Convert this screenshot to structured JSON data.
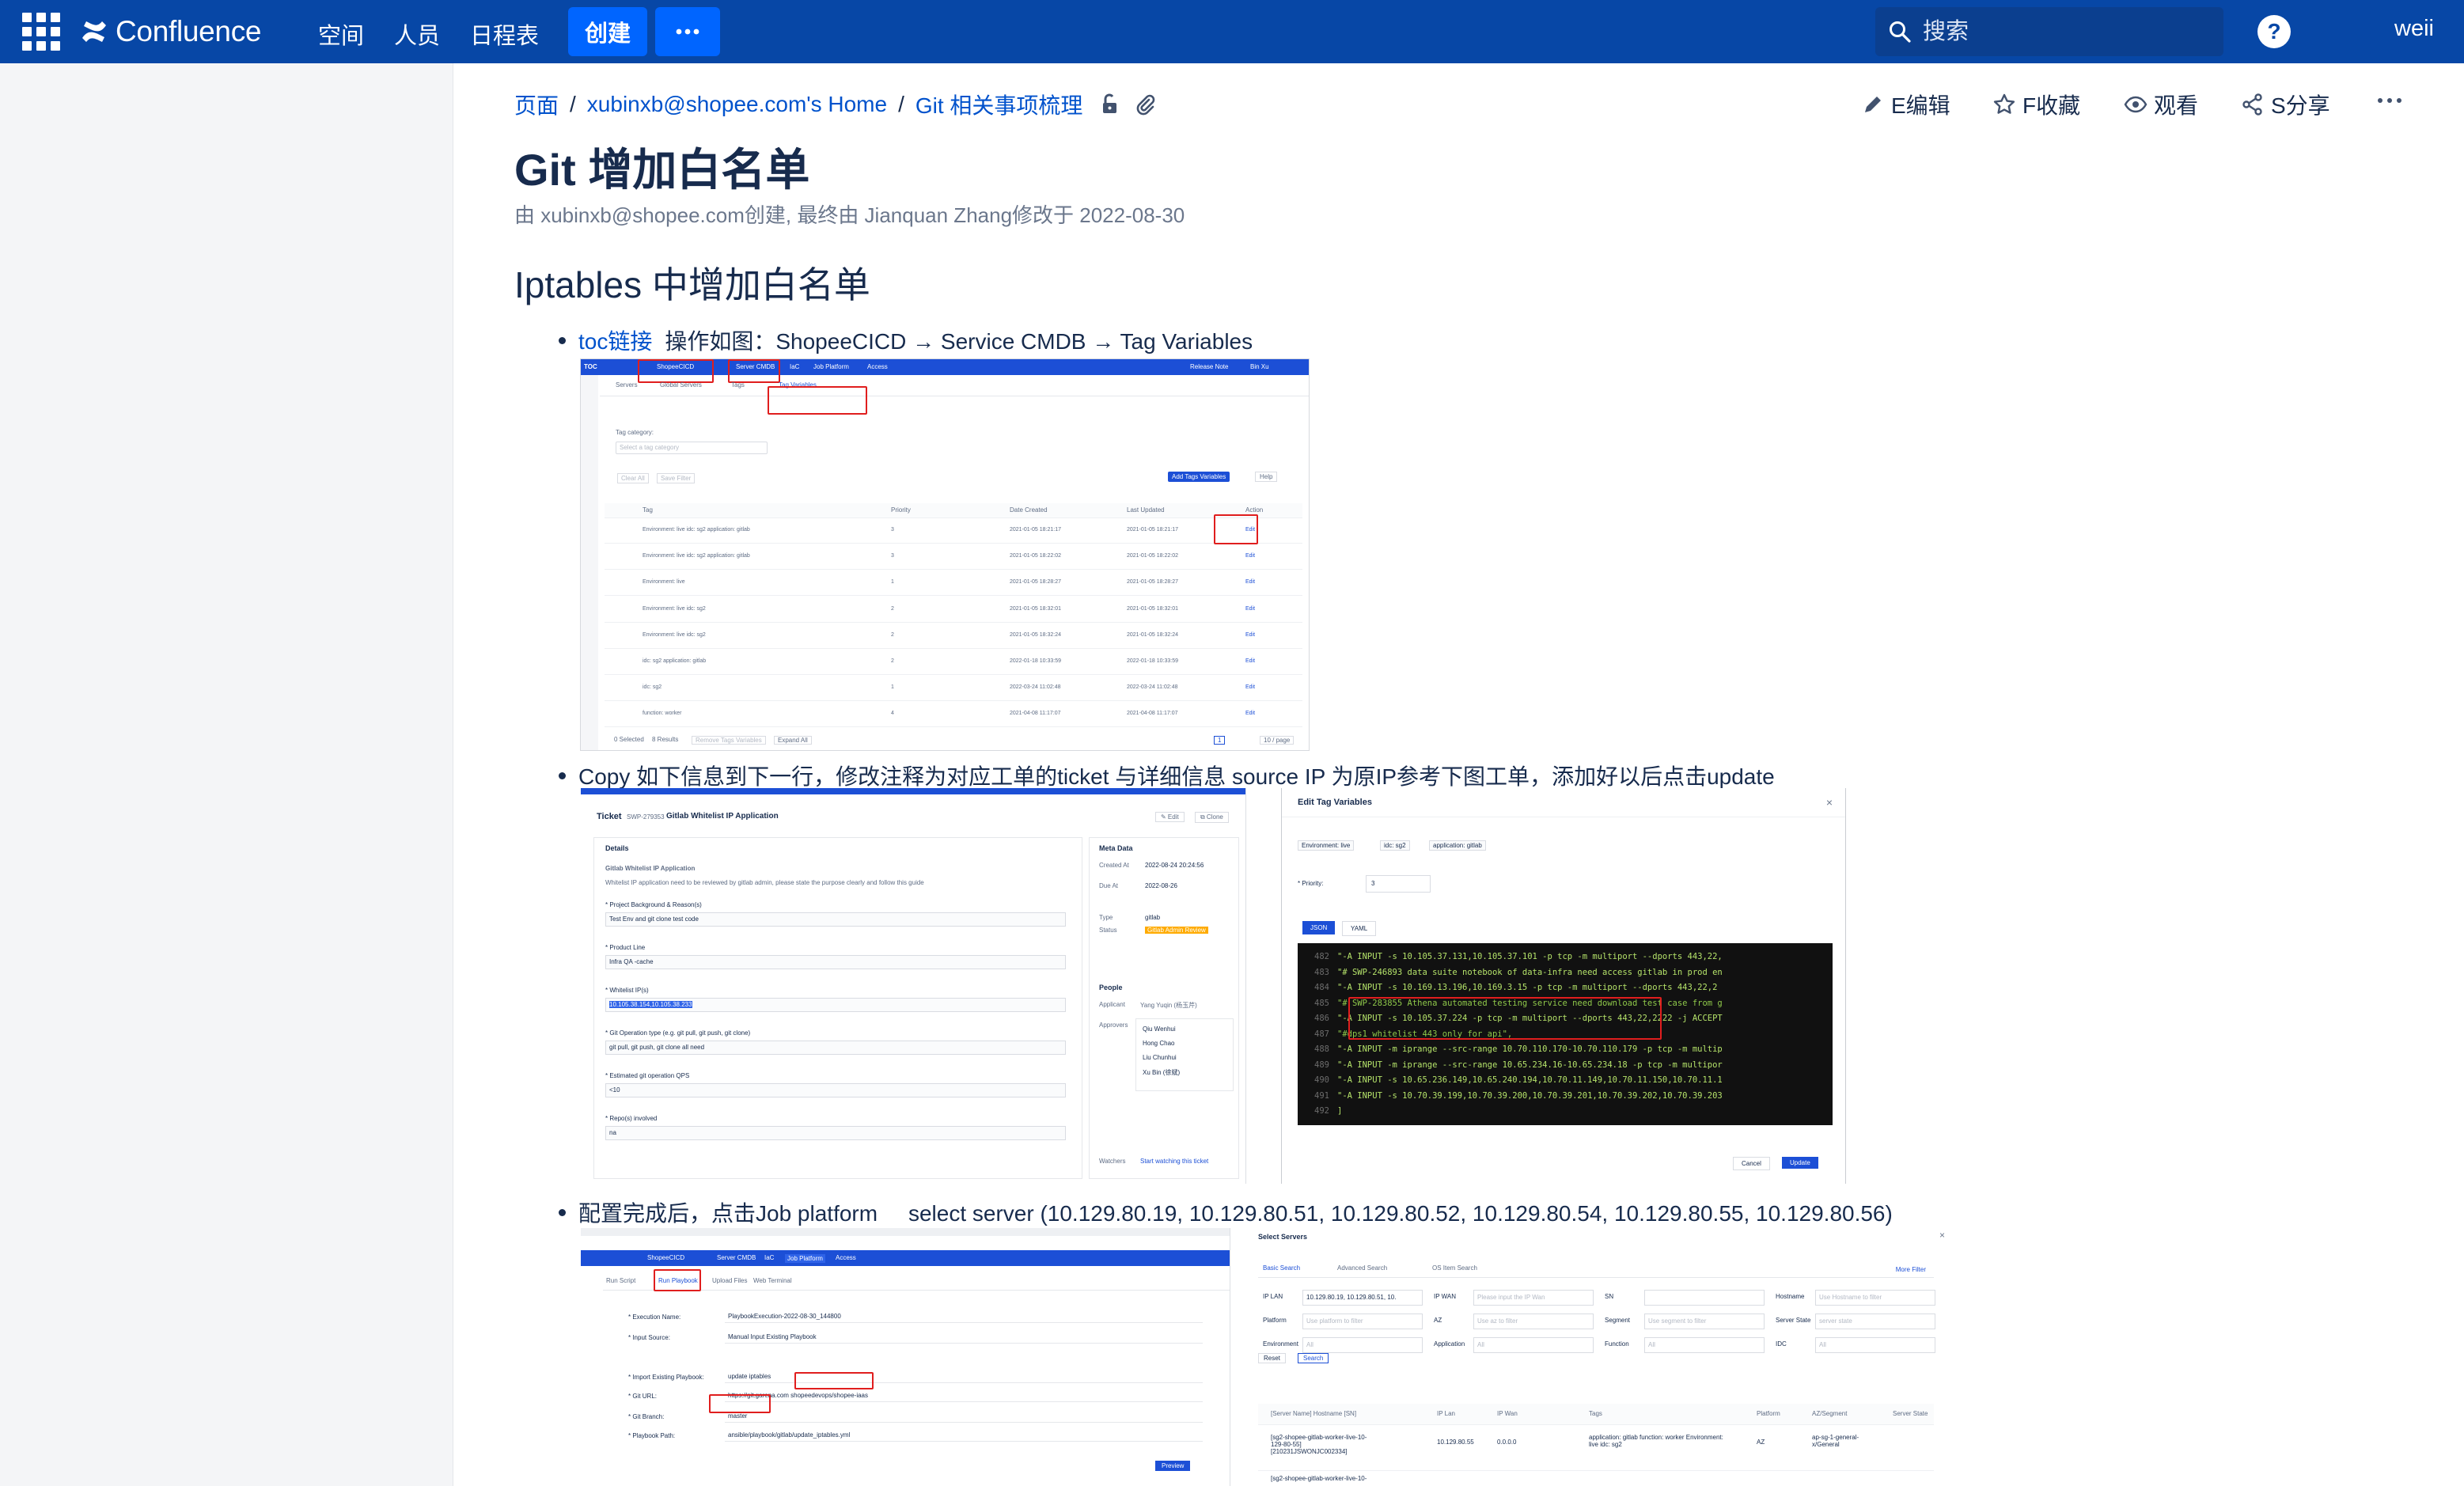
{
  "nav": {
    "brand": "Confluence",
    "links": [
      "空间",
      "人员",
      "日程表"
    ],
    "create": "创建",
    "search_placeholder": "搜索",
    "user": "weii"
  },
  "breadcrumb": [
    "页面",
    "xubinxb@shopee.com's Home",
    "Git 相关事项梳理"
  ],
  "actions": {
    "edit": "E编辑",
    "favorite": "F收藏",
    "watch": "观看",
    "share": "S分享"
  },
  "page": {
    "title": "Git 增加白名单",
    "byline": "由 xubinxb@shopee.com创建, 最终由 Jianquan Zhang修改于 2022-08-30",
    "section": "Iptables 中增加白名单"
  },
  "bullets": {
    "b1_link": "toc链接",
    "b1_text": "操作如图：ShopeeCICD → Service CMDB → Tag Variables",
    "b2_text": "Copy 如下信息到下一行，修改注释为对应工单的ticket 与详细信息 source IP 为原IP参考下图工单，添加好以后点击update",
    "b3_text": "配置完成后，点击Job platform     select server (10.129.80.19, 10.129.80.51, 10.129.80.52, 10.129.80.54, 10.129.80.55, 10.129.80.56)"
  },
  "shot1": {
    "menu": [
      "ShopeeCICD",
      "Server CMDB",
      "IaC",
      "Job Platform",
      "Access"
    ],
    "right": [
      "Release Note",
      "Bin Xu"
    ],
    "tabs": [
      "Servers",
      "Global Servers",
      "Tags",
      "Tag Variables"
    ],
    "filter_label": "Tag category:",
    "filter_placeholder": "Select a tag category",
    "buttons": [
      "Clear All",
      "Save Filter"
    ],
    "add_btn": "Add Tags Variables",
    "help_btn": "Help",
    "headers": [
      "Tag",
      "Priority",
      "Date Created",
      "Last Updated",
      "Action"
    ],
    "rows": [
      {
        "tags": "Environment: live   idc: sg2   application: gitlab",
        "p": "3",
        "c": "2021-01-05 18:21:17",
        "u": "2021-01-05 18:21:17",
        "a": "Edit"
      },
      {
        "tags": "Environment: live   idc: sg2   application: gitlab",
        "p": "3",
        "c": "2021-01-05 18:22:02",
        "u": "2021-01-05 18:22:02",
        "a": "Edit"
      },
      {
        "tags": "Environment: live",
        "p": "1",
        "c": "2021-01-05 18:28:27",
        "u": "2021-01-05 18:28:27",
        "a": "Edit"
      },
      {
        "tags": "Environment: live   idc: sg2",
        "p": "2",
        "c": "2021-01-05 18:32:01",
        "u": "2021-01-05 18:32:01",
        "a": "Edit"
      },
      {
        "tags": "Environment: live   idc: sg2",
        "p": "2",
        "c": "2021-01-05 18:32:24",
        "u": "2021-01-05 18:32:24",
        "a": "Edit"
      },
      {
        "tags": "idc: sg2   application: gitlab",
        "p": "2",
        "c": "2022-01-18 10:33:59",
        "u": "2022-01-18 10:33:59",
        "a": "Edit"
      },
      {
        "tags": "idc: sg2",
        "p": "1",
        "c": "2022-03-24 11:02:48",
        "u": "2022-03-24 11:02:48",
        "a": "Edit"
      },
      {
        "tags": "function: worker",
        "p": "4",
        "c": "2021-04-08 11:17:07",
        "u": "2021-04-08 11:17:07",
        "a": "Edit"
      }
    ],
    "footer": [
      "0 Selected",
      "8 Results",
      "Remove Tags Variables",
      "Expand All",
      "10 / page"
    ]
  },
  "shot2": {
    "ticket_label": "Ticket",
    "ticket_id": "SWP-279353",
    "ticket_title": "Gitlab Whitelist IP Application",
    "details": "Details",
    "meta": "Meta Data",
    "desc1": "Gitlab Whitelist IP Application",
    "desc2": "Whitelist IP application need to be reviewed by gitlab admin, please state the purpose clearly and follow this guide",
    "fields": [
      {
        "label": "* Project Background & Reason(s)",
        "value": "Test Env and git clone test code"
      },
      {
        "label": "* Product Line",
        "value": "Infra QA -cache"
      },
      {
        "label": "* Whitelist IP(s)",
        "value": "10.105.38.154,10.105.38.233"
      },
      {
        "label": "* Git Operation type (e.g. git pull, git push, git clone)",
        "value": "git pull, git push, git clone all need"
      },
      {
        "label": "* Estimated git operation QPS",
        "value": "<10"
      },
      {
        "label": "* Repo(s) involved",
        "value": "na"
      }
    ],
    "meta_rows": [
      {
        "k": "Created At",
        "v": "2022-08-24 20:24:56"
      },
      {
        "k": "Due At",
        "v": "2022-08-26"
      },
      {
        "k": "Type",
        "v": "gitlab"
      },
      {
        "k": "Status",
        "v": "Gitlab Admin Review"
      }
    ],
    "people": "People",
    "applicant": "Yang Yuqin (杨玉芹)",
    "approvers": [
      "Qiu Wenhui",
      "Hong Chao",
      "Liu Chunhui",
      "Xu Bin (徐斌)"
    ],
    "watch": "Start watching this ticket",
    "modal_title": "Edit Tag Variables",
    "modal_tags": [
      "Environment: live",
      "idc: sg2",
      "application: gitlab"
    ],
    "priority_label": "* Priority:",
    "priority_value": "3",
    "tabs": [
      "JSON",
      "YAML"
    ],
    "code_lines": [
      {
        "n": "482",
        "t": "\"-A INPUT -s 10.105.37.131,10.105.37.101 -p tcp -m multiport --dports 443,22,"
      },
      {
        "n": "483",
        "t": "\"# SWP-246893 data suite notebook of data-infra need access gitlab in prod en"
      },
      {
        "n": "484",
        "t": "\"-A INPUT -s 10.169.13.196,10.169.3.15 -p tcp -m multiport --dports 443,22,2"
      },
      {
        "n": "485",
        "t": "\"# SWP-283855 Athena automated testing service need download test case from g"
      },
      {
        "n": "486",
        "t": "\"-A INPUT -s 10.105.37.224 -p tcp -m multiport --dports 443,22,2222 -j ACCEPT"
      },
      {
        "n": "487",
        "t": "\"#dps1 whitelist 443 only for api\","
      },
      {
        "n": "488",
        "t": "\"-A INPUT -m iprange --src-range 10.70.110.170-10.70.110.179 -p tcp -m multip"
      },
      {
        "n": "489",
        "t": "\"-A INPUT -m iprange --src-range 10.65.234.16-10.65.234.18 -p tcp -m multipor"
      },
      {
        "n": "490",
        "t": "\"-A INPUT -s 10.65.236.149,10.65.240.194,10.70.11.149,10.70.11.150,10.70.11.1"
      },
      {
        "n": "491",
        "t": "\"-A INPUT -s 10.70.39.199,10.70.39.200,10.70.39.201,10.70.39.202,10.70.39.203"
      },
      {
        "n": "492",
        "t": "]"
      }
    ],
    "cancel": "Cancel",
    "update": "Update"
  },
  "shot3": {
    "tabs": [
      "Run Script",
      "Run Playbook",
      "Upload Files",
      "Web Terminal"
    ],
    "form": [
      {
        "k": "* Execution Name:",
        "v": "PlaybookExecution-2022-08-30_144800"
      },
      {
        "k": "* Input Source:",
        "v": "Manual Input    Existing Playbook"
      },
      {
        "k": "* Import Existing Playbook:",
        "v": "update iptables"
      },
      {
        "k": "* Git URL:",
        "v": "https://git.garena.com    shopeedevops/shopee-iaas"
      },
      {
        "k": "* Git Branch:",
        "v": "master"
      },
      {
        "k": "* Playbook Path:",
        "v": "ansible/playbook/gitlab/update_iptables.yml"
      }
    ],
    "preview": "Preview",
    "ss_title": "Select Servers",
    "ss_tabs": [
      "Basic Search",
      "Advanced Search",
      "OS Item Search"
    ],
    "more_filter": "More Filter",
    "filters": [
      {
        "k": "IP LAN",
        "v": "10.129.80.19, 10.129.80.51, 10."
      },
      {
        "k": "IP WAN",
        "v": "Please input the IP Wan"
      },
      {
        "k": "SN",
        "v": ""
      },
      {
        "k": "Hostname",
        "v": "Use Hostname to filter"
      },
      {
        "k": "Platform",
        "v": "Use platform to filter"
      },
      {
        "k": "AZ",
        "v": "Use az to filter"
      },
      {
        "k": "Segment",
        "v": "Use segment to filter"
      },
      {
        "k": "Server State",
        "v": "server state"
      },
      {
        "k": "Environment",
        "v": "All"
      },
      {
        "k": "Application",
        "v": "All"
      },
      {
        "k": "Function",
        "v": "All"
      },
      {
        "k": "IDC",
        "v": "All"
      }
    ],
    "reset": "Reset",
    "search": "Search",
    "cols": [
      "[Server Name] Hostname [SN]",
      "IP Lan",
      "IP Wan",
      "Tags",
      "Platform",
      "AZ/Segment",
      "Server State"
    ],
    "row": {
      "host": "[sg2-shopee-gitlab-worker-live-10-129-80-55] [210231JSWONJC002334]",
      "lan": "10.129.80.55",
      "wan": "0.0.0.0",
      "tags": "application: gitlab  function: worker  Environment: live  idc: sg2",
      "platform": "AZ",
      "az": "ap-sg-1-general-x/General"
    },
    "row2": "[sg2-shopee-gitlab-worker-live-10-"
  }
}
